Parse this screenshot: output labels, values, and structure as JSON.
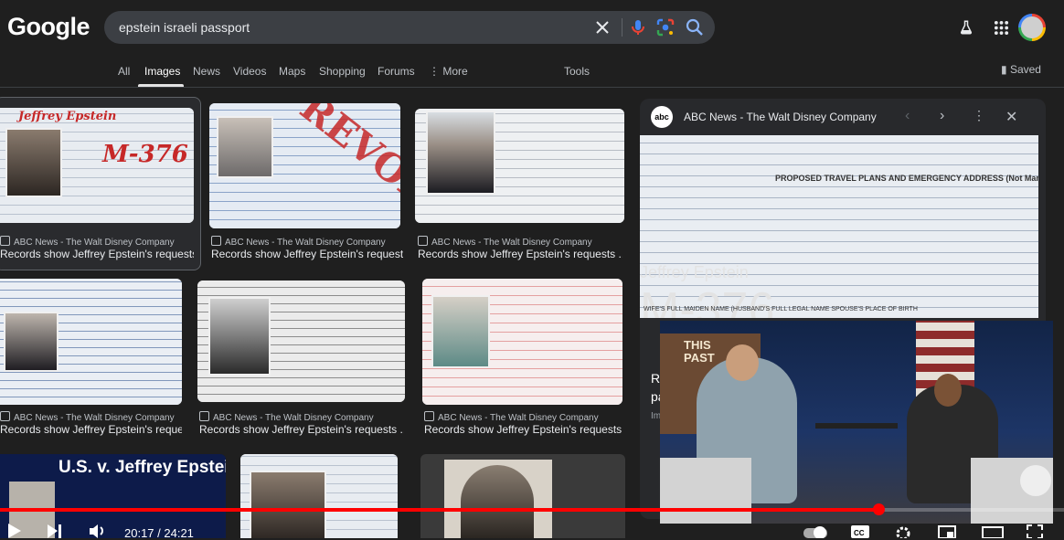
{
  "header": {
    "logo": "Google",
    "search_query": "epstein israeli passport"
  },
  "tabs": [
    {
      "label": "All"
    },
    {
      "label": "Images"
    },
    {
      "label": "News"
    },
    {
      "label": "Videos"
    },
    {
      "label": "Maps"
    },
    {
      "label": "Shopping"
    },
    {
      "label": "Forums"
    },
    {
      "label": "More"
    }
  ],
  "tools_label": "Tools",
  "saved_label": "Saved",
  "results": [
    {
      "source": "ABC News - The Walt Disney Company",
      "title": "Records show Jeffrey Epstein's requests ..."
    },
    {
      "source": "ABC News - The Walt Disney Company",
      "title": "Records show Jeffrey Epstein's request..."
    },
    {
      "source": "ABC News - The Walt Disney Company",
      "title": "Records show Jeffrey Epstein's requests ..."
    },
    {
      "source": "ABC News - The Walt Disney Company",
      "title": "Records show Jeffrey Epstein's reques..."
    },
    {
      "source": "ABC News - The Walt Disney Company",
      "title": "Records show Jeffrey Epstein's requests ..."
    },
    {
      "source": "ABC News - The Walt Disney Company",
      "title": "Records show Jeffrey Epstein's requests ..."
    }
  ],
  "image_marks": {
    "name_scrawl": "Jeffrey Epstein",
    "m376": "M-376",
    "revoked": "REVOKED",
    "usv_title": "U.S. v. Jeffrey Epstein"
  },
  "panel": {
    "logo": "abc",
    "title": "ABC News - The Walt Disney Company",
    "cut_line1": "Re",
    "cut_line2": "pa",
    "cut_line3": "Im",
    "form_header": "PROPOSED TRAVEL PLANS AND EMERGENCY ADDRESS (Not Mand",
    "form_footer": "WIFE'S FULL MAIDEN NAME (HUSBAND'S FULL LEGAL NAME   SPOUSE'S PLACE OF BIRTH"
  },
  "video": {
    "timecode": "20:17 / 24:21",
    "progress": 0.826,
    "set_sign": "THIS PAST"
  },
  "colors": {
    "background": "#1f1f1f",
    "search_box": "#3c3f44",
    "progress_red": "#ff0000",
    "scrawl_red": "#c62828"
  }
}
